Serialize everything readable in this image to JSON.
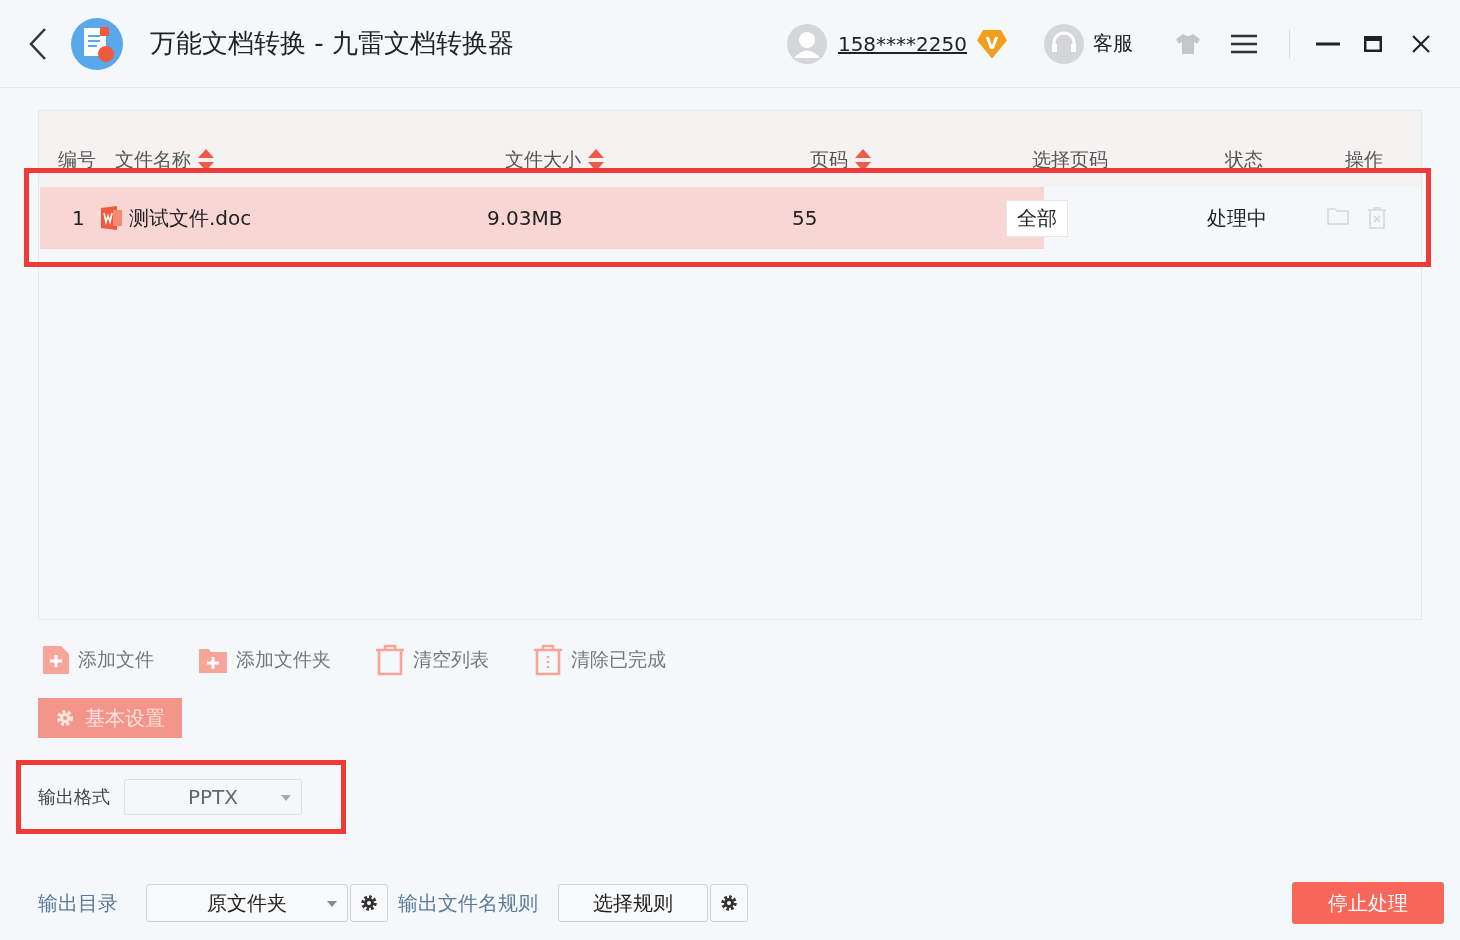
{
  "window": {
    "title": "万能文档转换 - 九雷文档转换器"
  },
  "header": {
    "account": "158****2250",
    "vip_badge": "V",
    "support": "客服"
  },
  "table": {
    "columns": [
      {
        "label": "编号",
        "sortable": false
      },
      {
        "label": "文件名称",
        "sortable": true
      },
      {
        "label": "文件大小",
        "sortable": true
      },
      {
        "label": "页码",
        "sortable": true
      },
      {
        "label": "选择页码",
        "sortable": false
      },
      {
        "label": "状态",
        "sortable": false
      },
      {
        "label": "操作",
        "sortable": false
      }
    ],
    "rows": [
      {
        "index": "1",
        "name": "测试文件.doc",
        "size": "9.03MB",
        "pages": "55",
        "page_range": "全部",
        "status": "处理中",
        "selected": true
      }
    ]
  },
  "toolbar": [
    {
      "kind": "add-file",
      "label": "添加文件"
    },
    {
      "kind": "add-folder",
      "label": "添加文件夹"
    },
    {
      "kind": "clear",
      "label": "清空列表"
    },
    {
      "kind": "clear-done",
      "label": "清除已完成"
    }
  ],
  "settings_tab": {
    "label": "基本设置"
  },
  "output_format": {
    "label": "输出格式",
    "value": "PPTX"
  },
  "output_dir": {
    "label": "输出目录",
    "value": "原文件夹"
  },
  "name_rule": {
    "label": "输出文件名规则",
    "value": "选择规则"
  },
  "stop_button": {
    "label": "停止处理"
  }
}
